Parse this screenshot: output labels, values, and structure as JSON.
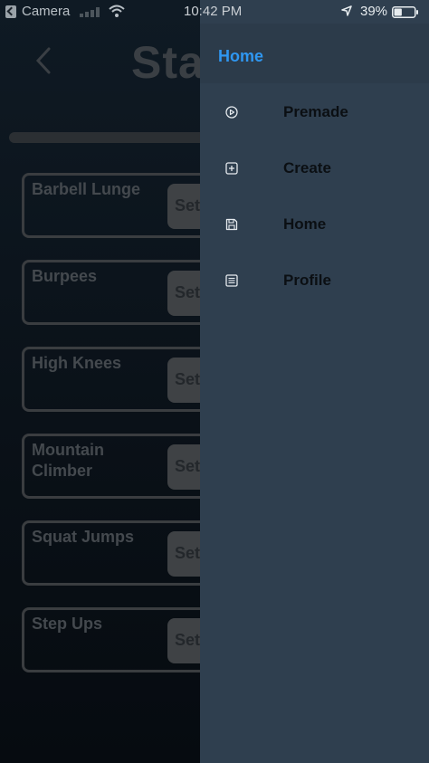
{
  "status_bar": {
    "carrier": "Camera",
    "time": "10:42 PM",
    "battery_percent": "39%",
    "battery_level": 0.39,
    "icons": [
      "back-to-app-icon",
      "signal-icon",
      "wifi-icon",
      "location-arrow-icon",
      "battery-icon"
    ]
  },
  "page": {
    "title": "Sta",
    "back_icon": "chevron-left-icon",
    "exercises": [
      {
        "name": "Barbell Lunge",
        "sets_label": "Sets"
      },
      {
        "name": "Burpees",
        "sets_label": "Sets"
      },
      {
        "name": "High Knees",
        "sets_label": "Sets"
      },
      {
        "name": "Mountain Climber",
        "sets_label": "Sets"
      },
      {
        "name": "Squat Jumps",
        "sets_label": "Sets"
      },
      {
        "name": "Step Ups",
        "sets_label": "Sets"
      }
    ]
  },
  "drawer": {
    "header_title": "Home",
    "items": [
      {
        "label": "Premade",
        "icon": "play-circle-icon"
      },
      {
        "label": "Create",
        "icon": "plus-square-icon"
      },
      {
        "label": "Home",
        "icon": "save-icon"
      },
      {
        "label": "Profile",
        "icon": "list-icon"
      }
    ]
  },
  "colors": {
    "drawer_bg": "#2f3f4f",
    "drawer_header_accent": "#2f97f1",
    "page_bg": "#0a1118"
  }
}
